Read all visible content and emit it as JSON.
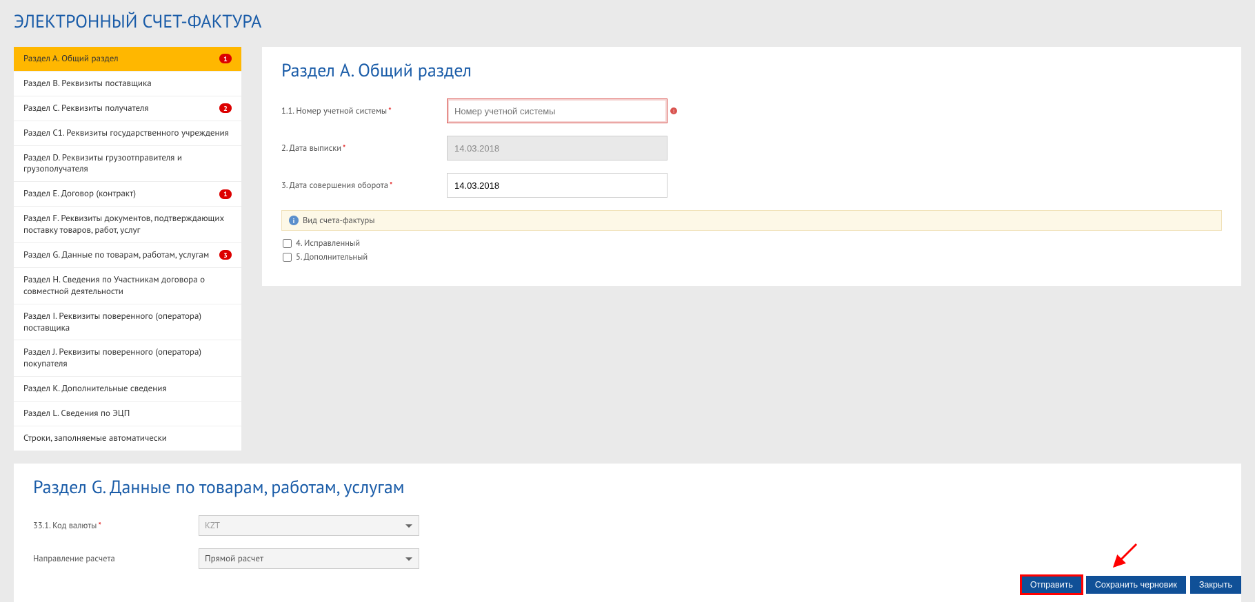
{
  "header": {
    "title": "ЭЛЕКТРОННЫЙ СЧЕТ-ФАКТУРА"
  },
  "sidebar": {
    "items": [
      {
        "label": "Раздел А. Общий раздел",
        "badge": "1",
        "active": true
      },
      {
        "label": "Раздел B. Реквизиты поставщика",
        "badge": null
      },
      {
        "label": "Раздел C. Реквизиты получателя",
        "badge": "2"
      },
      {
        "label": "Раздел C1. Реквизиты государственного учреждения",
        "badge": null
      },
      {
        "label": "Раздел D. Реквизиты грузоотправителя и грузополучателя",
        "badge": null
      },
      {
        "label": "Раздел E. Договор (контракт)",
        "badge": "1"
      },
      {
        "label": "Раздел F. Реквизиты документов, подтверждающих поставку товаров, работ, услуг",
        "badge": null
      },
      {
        "label": "Раздел G. Данные по товарам, работам, услугам",
        "badge": "3"
      },
      {
        "label": "Раздел H. Сведения по Участникам договора о совместной деятельности",
        "badge": null
      },
      {
        "label": "Раздел I. Реквизиты поверенного (оператора) поставщика",
        "badge": null
      },
      {
        "label": "Раздел J. Реквизиты поверенного (оператора) покупателя",
        "badge": null
      },
      {
        "label": "Раздел K. Дополнительные сведения",
        "badge": null
      },
      {
        "label": "Раздел L. Сведения по ЭЦП",
        "badge": null
      },
      {
        "label": "Строки, заполняемые автоматически",
        "badge": null
      }
    ]
  },
  "sectionA": {
    "title": "Раздел A. Общий раздел",
    "fields": {
      "accountNumber": {
        "label": "1.1. Номер учетной системы",
        "placeholder": "Номер учетной системы",
        "value": ""
      },
      "issueDate": {
        "label": "2. Дата выписки",
        "value": "14.03.2018"
      },
      "turnoverDate": {
        "label": "3. Дата совершения оборота",
        "value": "14.03.2018"
      }
    },
    "invoiceType": {
      "label": "Вид счета-фактуры",
      "options": {
        "corrected": "4. Исправленный",
        "additional": "5. Дополнительный"
      }
    }
  },
  "sectionG": {
    "title": "Раздел G. Данные по товарам, работам, услугам",
    "fields": {
      "currency": {
        "label": "33.1. Код валюты",
        "value": "KZT"
      },
      "calcDirection": {
        "label": "Направление расчета",
        "value": "Прямой расчет"
      }
    }
  },
  "footer": {
    "send": "Отправить",
    "saveDraft": "Сохранить черновик",
    "close": "Закрыть"
  }
}
